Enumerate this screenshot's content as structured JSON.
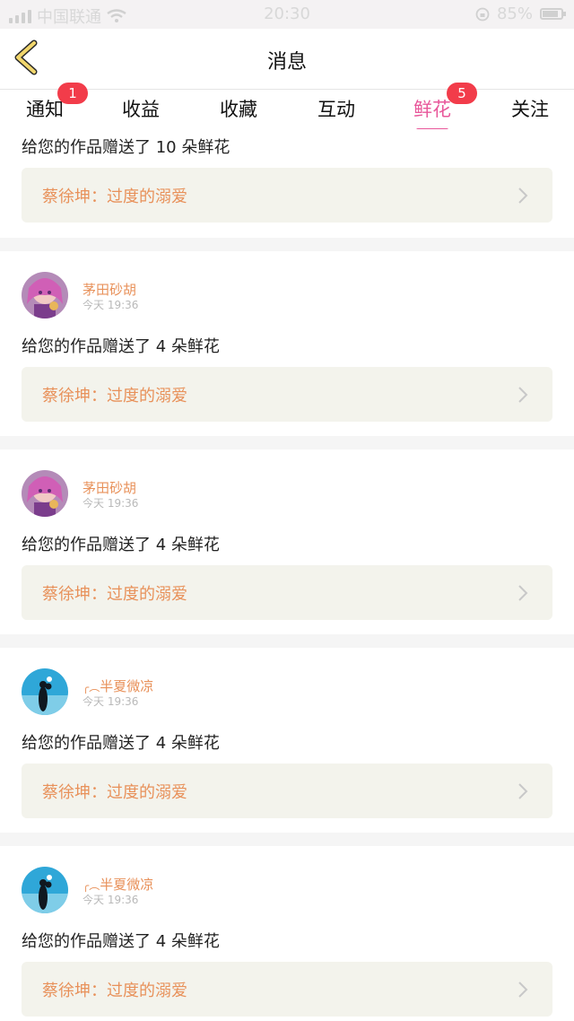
{
  "status_bar": {
    "carrier": "中国联通",
    "time": "20:30",
    "battery": "85%"
  },
  "header": {
    "title": "消息"
  },
  "tabs": [
    {
      "label": "通知",
      "badge": "1",
      "active": false
    },
    {
      "label": "收益",
      "badge": "",
      "active": false
    },
    {
      "label": "收藏",
      "badge": "",
      "active": false
    },
    {
      "label": "互动",
      "badge": "",
      "active": false
    },
    {
      "label": "鲜花",
      "badge": "5",
      "active": true
    },
    {
      "label": "关注",
      "badge": "",
      "active": false
    }
  ],
  "messages": [
    {
      "message": "给您的作品赠送了 10 朵鲜花",
      "work_title": "蔡徐坤：过度的溺爱"
    },
    {
      "username": "茅田砂胡",
      "time": "今天 19:36",
      "message": "给您的作品赠送了 4 朵鲜花",
      "work_title": "蔡徐坤：过度的溺爱",
      "avatar": "anime-girl-avatar"
    },
    {
      "username": "茅田砂胡",
      "time": "今天 19:36",
      "message": "给您的作品赠送了 4 朵鲜花",
      "work_title": "蔡徐坤：过度的溺爱",
      "avatar": "anime-girl-avatar"
    },
    {
      "username": "半夏微凉",
      "time": "今天 19:36",
      "message": "给您的作品赠送了 4 朵鲜花",
      "work_title": "蔡徐坤：过度的溺爱",
      "avatar": "sunset-couple-avatar"
    },
    {
      "username": "半夏微凉",
      "time": "今天 19:36",
      "message": "给您的作品赠送了 4 朵鲜花",
      "work_title": "蔡徐坤：过度的溺爱",
      "avatar": "sunset-couple-avatar"
    }
  ],
  "colors": {
    "accent_pink": "#e8579a",
    "name_orange": "#e8915a",
    "badge_red": "#f23c4a",
    "card_bg": "#f3f3ec"
  }
}
